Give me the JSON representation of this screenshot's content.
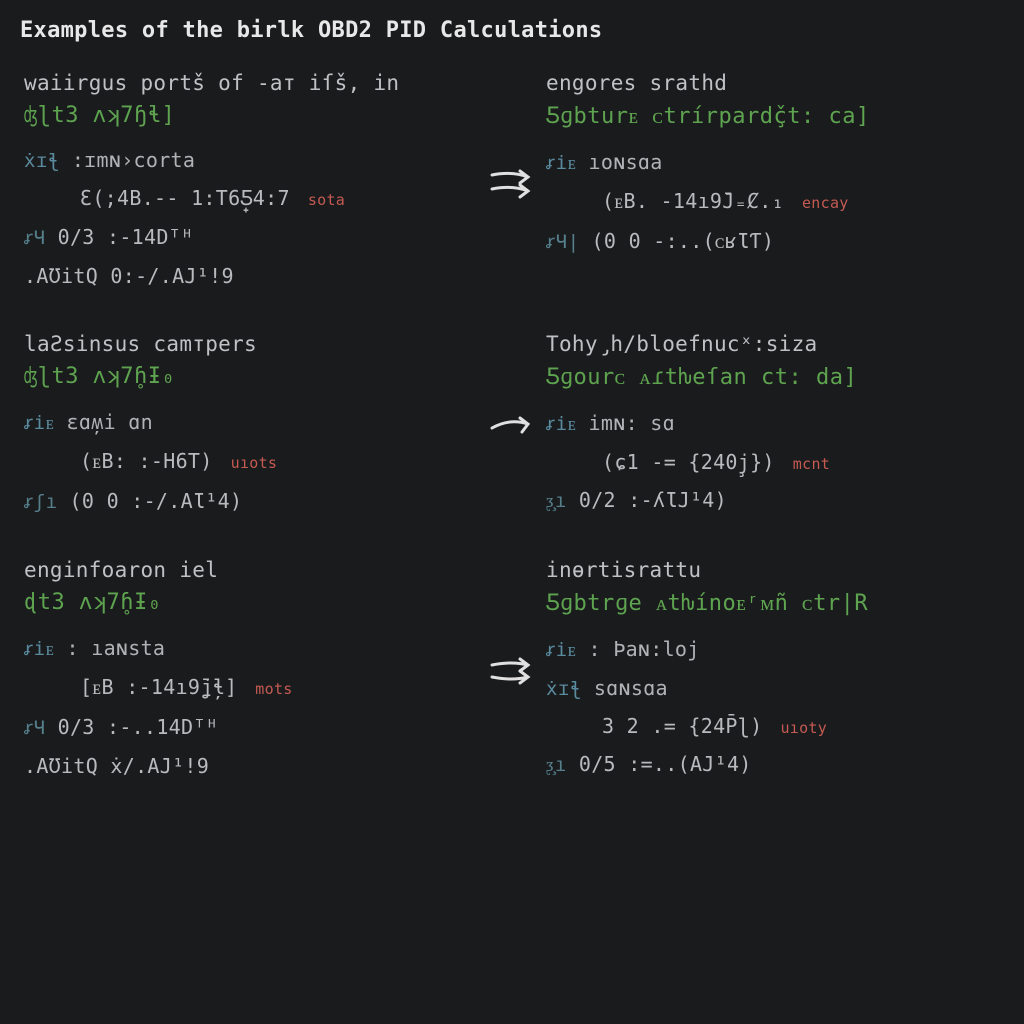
{
  "title": "Examples of the birlk OBD2 PID Calculations",
  "blocks": {
    "tl": {
      "heading": "waiirgus portš of -aт iſš, in",
      "greensub": "ʤɭt3 ʌʞ7ɧɬ]",
      "l1_key": "ẋɪꞎ",
      "l1_val": ":ɪmɴ›corta",
      "l2_val": "Ɛ(;4B.-- 1꞉T6̟Ƽ4꞉7",
      "l2_tag": "sota",
      "l3_key": "ꭉꞍ",
      "l3_val": "0/3 :-14Dᵀᴴ",
      "l4_val": ".AƱitQ  0꞉-/.AJ¹ǃ9"
    },
    "tr": {
      "heading": "engores srathd",
      "greensub": "Ƽɡbturᴇ ᴄtrírpardç̌t꞉ ca]",
      "l1_key": "ꭉiᴇ",
      "l1_val": "ıoɴsɑa",
      "l2_val": "(ᴇB. -14ı9̄J₌Ȼ.₁",
      "l2_tag": "encay",
      "l3_key": "ꭉꞍ|",
      "l3_val": "(0  0 -꞉..(ᴄʁƖƬ)"
    },
    "ml": {
      "heading": "laƧsinsus camтpers",
      "greensub": "ʤɭt3 ʌʞ7ɦ̥Ɨ₀",
      "l1_key": "ꭉiᴇ",
      "l1_val": "ɛɑʍ̦і ɑn",
      "l2_val": "(ᴇB꞉ :-H6T)",
      "l2_tag": "uıots",
      "l3_key": "ꭉʃı",
      "l3_val": "(0  0 :-/.AƖ¹4)"
    },
    "mr": {
      "heading": "Tohy̡h/bloefnucˣ꞉siza",
      "greensub": "Ƽɡourᴄ ᴀɾtƕeſan ct꞉ da]",
      "l1_key": "ꭉiᴇ",
      "l1_val": "imɴ: sɑ",
      "l2_val": "(ɕ1 -= {240j̧})",
      "l2_tag": "mcnt",
      "l3_key": "ᶚ̧ı",
      "l3_val": "0/2 :-ʎƖJ¹4)"
    },
    "bl": {
      "heading": "enginfoaron iel",
      "greensub": "ɖt3 ʌʞ7ɦ̥Ɨ₀",
      "l1_key": "ꭉiᴇ",
      "l1_val": ": ıaɴsta",
      "l2_val": "[ᴇB :-14ı9̄ʝɬ̦]",
      "l2_tag": "mots",
      "l3_key": "ꭉꞍ",
      "l3_val": "0/3 :-..14Dᵀᴴ",
      "l4_val": ".AƱitQ  ẋ/.AJ¹ǃ9"
    },
    "br": {
      "heading": "inɵrtіsrattu",
      "greensub": "Ƽɡbtrɡe ᴀtƕínoᴇʳᴍñ ᴄtr|R",
      "l1_key": "ꭉiᴇ",
      "l1_val": ": Þaɴ:loj",
      "l2_key": "ẋɪꞎ",
      "l2_val": "sɑɴsɑa",
      "l3_val": "3 2 .= {24P̄ɭ)",
      "l3_tag": "uıoty",
      "l4_key": "ᶚ̧ı",
      "l4_val": "0/5 ꞉=..(AJ¹4)"
    }
  }
}
